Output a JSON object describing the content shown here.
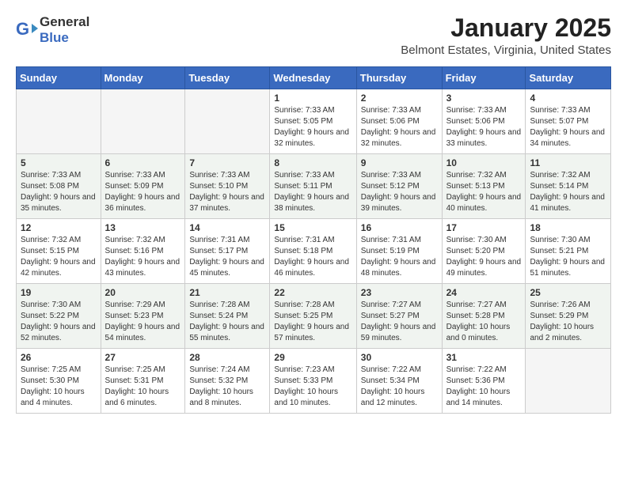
{
  "logo": {
    "text_general": "General",
    "text_blue": "Blue"
  },
  "title": "January 2025",
  "subtitle": "Belmont Estates, Virginia, United States",
  "weekdays": [
    "Sunday",
    "Monday",
    "Tuesday",
    "Wednesday",
    "Thursday",
    "Friday",
    "Saturday"
  ],
  "weeks": [
    [
      {
        "day": "",
        "info": ""
      },
      {
        "day": "",
        "info": ""
      },
      {
        "day": "",
        "info": ""
      },
      {
        "day": "1",
        "info": "Sunrise: 7:33 AM\nSunset: 5:05 PM\nDaylight: 9 hours and 32 minutes."
      },
      {
        "day": "2",
        "info": "Sunrise: 7:33 AM\nSunset: 5:06 PM\nDaylight: 9 hours and 32 minutes."
      },
      {
        "day": "3",
        "info": "Sunrise: 7:33 AM\nSunset: 5:06 PM\nDaylight: 9 hours and 33 minutes."
      },
      {
        "day": "4",
        "info": "Sunrise: 7:33 AM\nSunset: 5:07 PM\nDaylight: 9 hours and 34 minutes."
      }
    ],
    [
      {
        "day": "5",
        "info": "Sunrise: 7:33 AM\nSunset: 5:08 PM\nDaylight: 9 hours and 35 minutes."
      },
      {
        "day": "6",
        "info": "Sunrise: 7:33 AM\nSunset: 5:09 PM\nDaylight: 9 hours and 36 minutes."
      },
      {
        "day": "7",
        "info": "Sunrise: 7:33 AM\nSunset: 5:10 PM\nDaylight: 9 hours and 37 minutes."
      },
      {
        "day": "8",
        "info": "Sunrise: 7:33 AM\nSunset: 5:11 PM\nDaylight: 9 hours and 38 minutes."
      },
      {
        "day": "9",
        "info": "Sunrise: 7:33 AM\nSunset: 5:12 PM\nDaylight: 9 hours and 39 minutes."
      },
      {
        "day": "10",
        "info": "Sunrise: 7:32 AM\nSunset: 5:13 PM\nDaylight: 9 hours and 40 minutes."
      },
      {
        "day": "11",
        "info": "Sunrise: 7:32 AM\nSunset: 5:14 PM\nDaylight: 9 hours and 41 minutes."
      }
    ],
    [
      {
        "day": "12",
        "info": "Sunrise: 7:32 AM\nSunset: 5:15 PM\nDaylight: 9 hours and 42 minutes."
      },
      {
        "day": "13",
        "info": "Sunrise: 7:32 AM\nSunset: 5:16 PM\nDaylight: 9 hours and 43 minutes."
      },
      {
        "day": "14",
        "info": "Sunrise: 7:31 AM\nSunset: 5:17 PM\nDaylight: 9 hours and 45 minutes."
      },
      {
        "day": "15",
        "info": "Sunrise: 7:31 AM\nSunset: 5:18 PM\nDaylight: 9 hours and 46 minutes."
      },
      {
        "day": "16",
        "info": "Sunrise: 7:31 AM\nSunset: 5:19 PM\nDaylight: 9 hours and 48 minutes."
      },
      {
        "day": "17",
        "info": "Sunrise: 7:30 AM\nSunset: 5:20 PM\nDaylight: 9 hours and 49 minutes."
      },
      {
        "day": "18",
        "info": "Sunrise: 7:30 AM\nSunset: 5:21 PM\nDaylight: 9 hours and 51 minutes."
      }
    ],
    [
      {
        "day": "19",
        "info": "Sunrise: 7:30 AM\nSunset: 5:22 PM\nDaylight: 9 hours and 52 minutes."
      },
      {
        "day": "20",
        "info": "Sunrise: 7:29 AM\nSunset: 5:23 PM\nDaylight: 9 hours and 54 minutes."
      },
      {
        "day": "21",
        "info": "Sunrise: 7:28 AM\nSunset: 5:24 PM\nDaylight: 9 hours and 55 minutes."
      },
      {
        "day": "22",
        "info": "Sunrise: 7:28 AM\nSunset: 5:25 PM\nDaylight: 9 hours and 57 minutes."
      },
      {
        "day": "23",
        "info": "Sunrise: 7:27 AM\nSunset: 5:27 PM\nDaylight: 9 hours and 59 minutes."
      },
      {
        "day": "24",
        "info": "Sunrise: 7:27 AM\nSunset: 5:28 PM\nDaylight: 10 hours and 0 minutes."
      },
      {
        "day": "25",
        "info": "Sunrise: 7:26 AM\nSunset: 5:29 PM\nDaylight: 10 hours and 2 minutes."
      }
    ],
    [
      {
        "day": "26",
        "info": "Sunrise: 7:25 AM\nSunset: 5:30 PM\nDaylight: 10 hours and 4 minutes."
      },
      {
        "day": "27",
        "info": "Sunrise: 7:25 AM\nSunset: 5:31 PM\nDaylight: 10 hours and 6 minutes."
      },
      {
        "day": "28",
        "info": "Sunrise: 7:24 AM\nSunset: 5:32 PM\nDaylight: 10 hours and 8 minutes."
      },
      {
        "day": "29",
        "info": "Sunrise: 7:23 AM\nSunset: 5:33 PM\nDaylight: 10 hours and 10 minutes."
      },
      {
        "day": "30",
        "info": "Sunrise: 7:22 AM\nSunset: 5:34 PM\nDaylight: 10 hours and 12 minutes."
      },
      {
        "day": "31",
        "info": "Sunrise: 7:22 AM\nSunset: 5:36 PM\nDaylight: 10 hours and 14 minutes."
      },
      {
        "day": "",
        "info": ""
      }
    ]
  ]
}
